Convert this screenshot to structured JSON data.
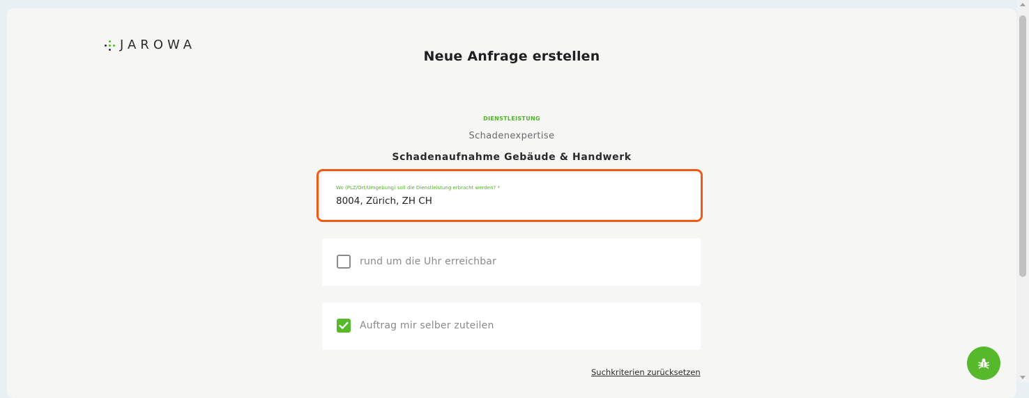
{
  "brand": {
    "name": "JAROWA"
  },
  "header": {
    "title": "Neue Anfrage erstellen"
  },
  "service": {
    "kicker": "DIENSTLEISTUNG",
    "name": "Schadenexpertise",
    "subcategory": "Schadenaufnahme Gebäude & Handwerk"
  },
  "location_field": {
    "label": "Wo (PLZ/Ort/Umgebung) soll die Dienstleistung erbracht werden? *",
    "value": "8004, Zürich, ZH CH"
  },
  "options": [
    {
      "label": "rund um die Uhr erreichbar",
      "checked": false
    },
    {
      "label": "Auftrag mir selber zuteilen",
      "checked": true
    }
  ],
  "reset_link": "Suchkriterien zurücksetzen",
  "icons": {
    "bug_button": "bug-icon",
    "checkmark": "check-icon"
  },
  "colors": {
    "accent": "#56b82b",
    "highlight": "#f05a14",
    "page_background": "#f6f6f4"
  }
}
